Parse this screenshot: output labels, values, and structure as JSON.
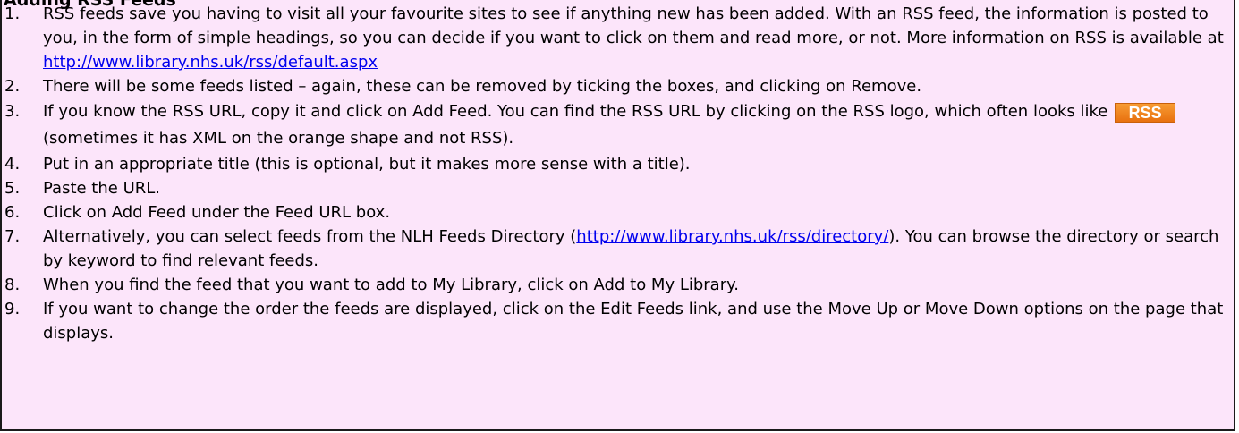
{
  "heading": "Adding RSS Feeds",
  "steps": [
    {
      "num": "1.",
      "text_a": "RSS feeds save you having to visit all your favourite sites to see if anything new has been added.  With an RSS feed, the information is posted to you, in the form of simple headings, so you can decide if you want to click on them and read more, or not.  More information on RSS is available at ",
      "link": "http://www.library.nhs.uk/rss/default.aspx"
    },
    {
      "num": "2.",
      "text_a": "There will be some feeds listed – again, these can be removed by ticking the boxes, and clicking on Remove."
    },
    {
      "num": "3.",
      "text_a": "If you know the RSS URL, copy it and click on Add Feed.  You can find the RSS URL by clicking on the RSS logo, which often looks like ",
      "badge": "RSS",
      "text_b": " (sometimes it has XML on the orange shape and not RSS)."
    },
    {
      "num": "4.",
      "text_a": "Put in an appropriate title (this is optional, but it makes more sense with a title)."
    },
    {
      "num": "5.",
      "text_a": "Paste the URL."
    },
    {
      "num": "6.",
      "text_a": "Click on Add Feed under the Feed URL box."
    },
    {
      "num": "7.",
      "text_a": "Alternatively, you can select feeds from the NLH Feeds Directory (",
      "link": "http://www.library.nhs.uk/rss/directory/",
      "text_b": ").  You can browse the directory or search by keyword to find relevant feeds."
    },
    {
      "num": "8.",
      "text_a": "When you find the feed that you want to add to My Library, click on Add to My Library."
    },
    {
      "num": "9.",
      "text_a": "If you want to change the order the feeds are displayed, click on the Edit Feeds link, and use the Move Up or Move Down options on the page that displays."
    }
  ],
  "colors": {
    "background": "#fce5fa",
    "border": "#1a1a1a",
    "link": "#0000ee",
    "badge": "#f0861f"
  }
}
